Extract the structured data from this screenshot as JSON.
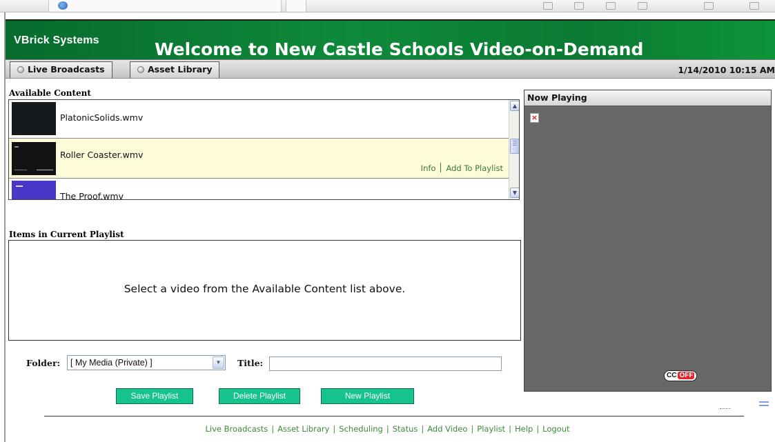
{
  "header": {
    "vendor": "VBrick Systems",
    "title": "Welcome to New Castle Schools Video-on-Demand",
    "colors": {
      "header_green": "#0b7a32",
      "accent_green": "#17c38d",
      "link_green": "#3c8a3c"
    }
  },
  "nav": {
    "tabs": [
      {
        "label": "Live Broadcasts"
      },
      {
        "label": "Asset Library"
      }
    ],
    "datetime": "1/14/2010 10:15 AM"
  },
  "available": {
    "label": "Available Content",
    "items": [
      {
        "title": "PlatonicSolids.wmv"
      },
      {
        "title": "Roller Coaster.wmv",
        "info_label": "Info",
        "add_label": "Add To Playlist"
      },
      {
        "title": "The Proof.wmv"
      }
    ]
  },
  "playlist": {
    "label": "Items in Current Playlist",
    "empty_message": "Select a video from the Available Content list above."
  },
  "form": {
    "folder_label": "Folder:",
    "folder_value": "[ My Media (Private) ]",
    "title_label": "Title:",
    "title_value": ""
  },
  "buttons": {
    "save": "Save Playlist",
    "delete": "Delete Playlist",
    "new": "New Playlist"
  },
  "now_playing": {
    "label": "Now Playing",
    "broken_image_glyph": "×",
    "cc_label": "CC",
    "cc_state": "OFF"
  },
  "footer": {
    "links": [
      "Live Broadcasts",
      "Asset Library",
      "Scheduling",
      "Status",
      "Add Video",
      "Playlist",
      "Help",
      "Logout"
    ]
  },
  "icons": {
    "nav_tab_icon": "radio-dot-icon",
    "scroll_up": "chevron-up-icon",
    "scroll_down": "chevron-down-icon",
    "select_arrow": "chevron-down-icon"
  }
}
